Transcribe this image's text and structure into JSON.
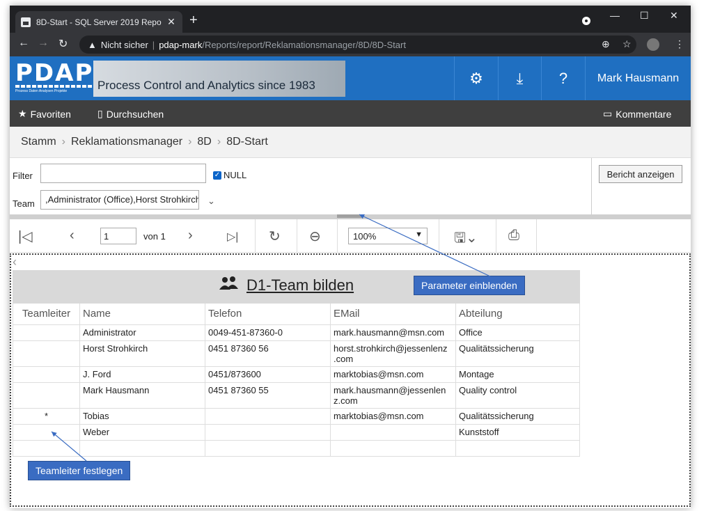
{
  "browser": {
    "tab_title": "8D-Start - SQL Server 2019 Repo",
    "tab_close": "✕",
    "new_tab": "+",
    "security_warning": "Nicht sicher",
    "url_host": "pdap-mark",
    "url_path": "/Reports/report/Reklamationsmanager/8D/8D-Start",
    "win_min": "—",
    "win_max": "☐",
    "win_close": "✕"
  },
  "app": {
    "logo_text": "PDAP",
    "logo_sub": "Prozess Daten Analysen Projekte",
    "banner_text": "Process Control and Analytics since 1983",
    "help_label": "?",
    "user_name": "Mark Hausmann"
  },
  "nav": {
    "favorites": "Favoriten",
    "browse": "Durchsuchen",
    "comments": "Kommentare"
  },
  "breadcrumb": [
    "Stamm",
    "Reklamationsmanager",
    "8D",
    "8D-Start"
  ],
  "params": {
    "filter_label": "Filter",
    "filter_value": "",
    "null_label": "NULL",
    "team_label": "Team",
    "team_value": ",Administrator (Office),Horst Strohkirch",
    "show_report": "Bericht anzeigen"
  },
  "toolbar": {
    "page_value": "1",
    "of_label": "von 1",
    "zoom_value": "100%"
  },
  "report": {
    "title": "D1-Team bilden",
    "columns": [
      "Teamleiter",
      "Name",
      "Telefon",
      "EMail",
      "Abteilung"
    ],
    "rows": [
      [
        "",
        "Administrator",
        "0049-451-87360-0",
        "mark.hausmann@msn.com",
        "Office"
      ],
      [
        "",
        "Horst Strohkirch",
        "0451 87360 56",
        "horst.strohkirch@jessenlenz .com",
        "Qualitätssicherung"
      ],
      [
        "",
        "J. Ford",
        "0451/873600",
        "marktobias@msn.com",
        "Montage"
      ],
      [
        "",
        "Mark Hausmann",
        "0451 87360 55",
        "mark.hausmann@jessenlen z.com",
        "Quality control"
      ],
      [
        "*",
        "Tobias",
        "",
        "marktobias@msn.com",
        "Qualitätssicherung"
      ],
      [
        "",
        "Weber",
        "",
        "",
        "Kunststoff"
      ],
      [
        "",
        "",
        "",
        "",
        ""
      ]
    ]
  },
  "annotations": {
    "params_callout": "Parameter einblenden",
    "leader_callout": "Teamleiter festlegen"
  }
}
